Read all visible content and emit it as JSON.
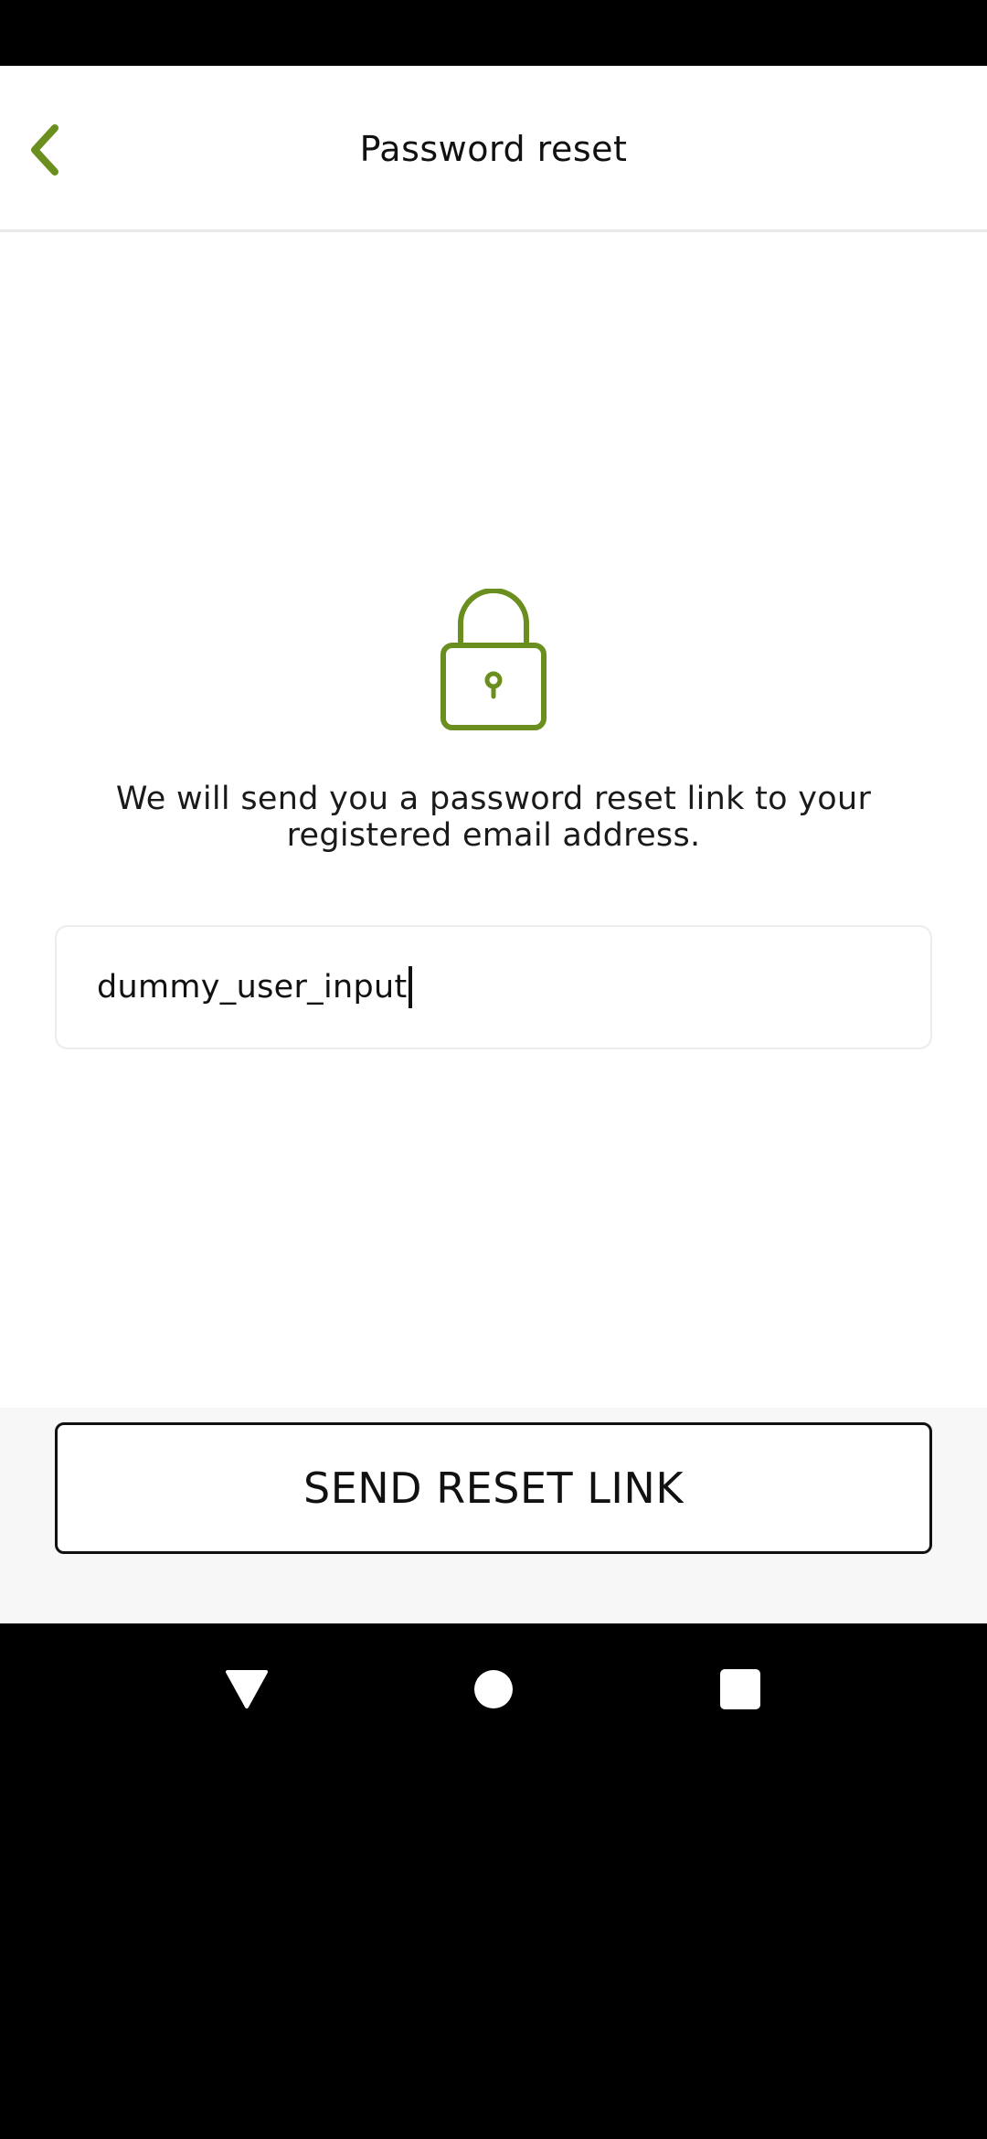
{
  "header": {
    "title": "Password reset",
    "back_icon": "chevron-left-icon"
  },
  "main": {
    "icon": "lock-icon",
    "description": "We will send you a password reset link to your registered email address.",
    "email_input": {
      "value": "dummy_user_input"
    },
    "send_button_label": "SEND RESET LINK"
  },
  "system_nav": {
    "back_icon": "triangle-back-icon",
    "home_icon": "circle-home-icon",
    "recents_icon": "square-recents-icon"
  },
  "colors": {
    "accent": "#6a8f1e",
    "text": "#111111",
    "input_border": "#ececec",
    "footer_bg": "#f7f7f7"
  }
}
